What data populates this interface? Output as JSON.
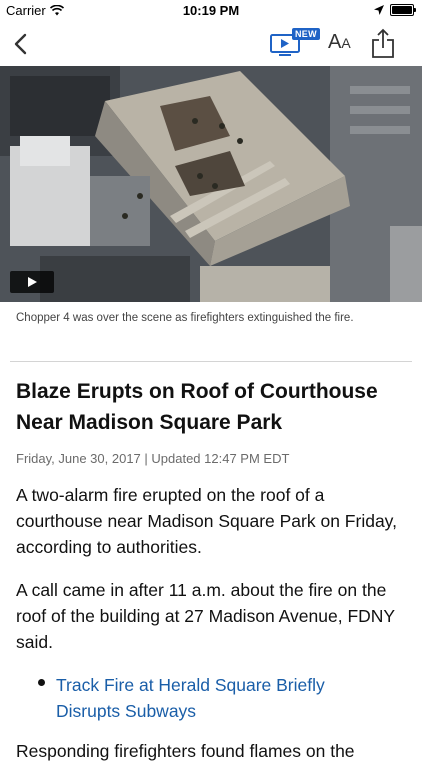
{
  "status_bar": {
    "carrier": "Carrier",
    "time": "10:19 PM"
  },
  "nav": {
    "video_badge": "NEW",
    "text_size_label_big": "A",
    "text_size_label_small": "A"
  },
  "media": {
    "caption": "Chopper 4 was over the scene as firefighters extinguished the fire."
  },
  "article": {
    "headline": "Blaze Erupts on Roof of Courthouse Near Madison Square Park",
    "dateline": "Friday, June 30, 2017  |  Updated 12:47 PM EDT",
    "paragraphs": [
      "A two-alarm fire erupted on the roof of a courthouse near Madison Square Park on Friday, according to authorities.",
      "A call came in after 11 a.m. about the fire on the roof of the building at 27 Madison Avenue, FDNY said."
    ],
    "related_link": "Track Fire at Herald Square Briefly Disrupts Subways",
    "partial_paragraph": "Responding firefighters found flames on the"
  },
  "colors": {
    "accent": "#1f63c6",
    "link": "#1a5ea8"
  }
}
